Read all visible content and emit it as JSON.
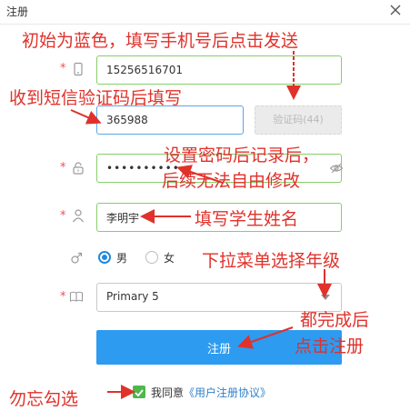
{
  "dialog": {
    "title": "注册"
  },
  "form": {
    "phone_value": "15256516701",
    "code_value": "365988",
    "code_button_label": "验证码(44)",
    "password_value": "••••••••••",
    "name_value": "李明宇",
    "gender_male": "男",
    "gender_female": "女",
    "grade_value": "Primary 5",
    "submit_label": "注册",
    "agree_text": "我同意",
    "agree_link": "《用户注册协议》"
  },
  "annotations": {
    "a1": "初始为蓝色，填写手机号后点击发送",
    "a2": "收到短信验证码后填写",
    "a3_line1": "设置密码后记录后，",
    "a3_line2": "后续无法自由修改",
    "a4": "填写学生姓名",
    "a5": "下拉菜单选择年级",
    "a6_line1": "都完成后",
    "a6_line2": "点击注册",
    "a7": "勿忘勾选"
  },
  "colors": {
    "annotation_red": "#e0312b",
    "submit_blue": "#2d9bf0",
    "checkbox_green": "#4fb74b",
    "field_green": "#86cf6a",
    "field_blue": "#5aa6e8"
  }
}
